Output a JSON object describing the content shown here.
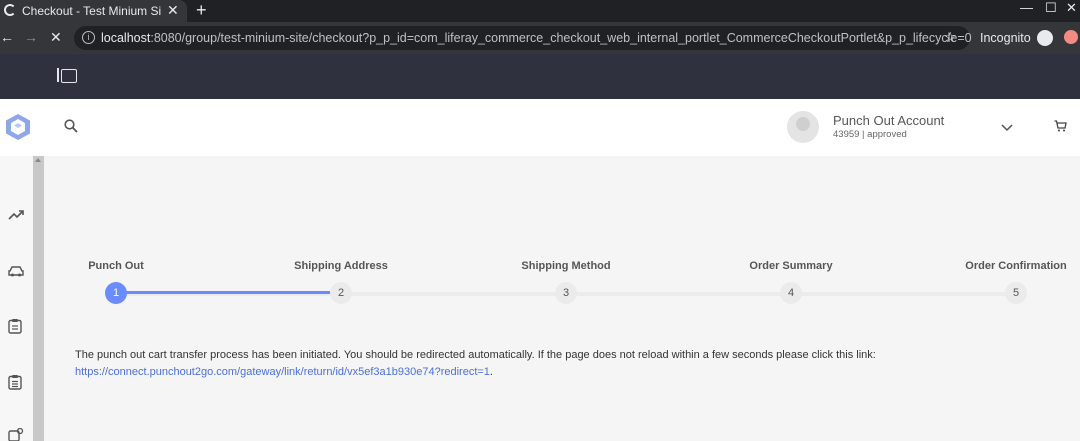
{
  "browser": {
    "tab_title": "Checkout - Test Minium Si",
    "new_tab": "+",
    "url_host": "localhost",
    "url_rest": ":8080/group/test-minium-site/checkout?p_p_id=com_liferay_commerce_checkout_web_internal_portlet_CommerceCheckoutPortlet&p_p_lifecycle=0",
    "incognito_label": "Incognito"
  },
  "account": {
    "name": "Punch Out Account",
    "status": "43959 | approved"
  },
  "steps": [
    {
      "label": "Punch Out",
      "number": "1"
    },
    {
      "label": "Shipping Address",
      "number": "2"
    },
    {
      "label": "Shipping Method",
      "number": "3"
    },
    {
      "label": "Order Summary",
      "number": "4"
    },
    {
      "label": "Order Confirmation",
      "number": "5"
    }
  ],
  "progress": {
    "active_step": 1,
    "completed_fraction": 0.25
  },
  "message": {
    "text": "The punch out cart transfer process has been initiated. You should be redirected automatically. If the page does not reload within a few seconds please click this link:",
    "link": "https://connect.punchout2go.com/gateway/link/return/id/vx5ef3a1b930e74?redirect=1",
    "suffix": "."
  },
  "colors": {
    "accent": "#6b8cff",
    "control_bar": "#30313f"
  },
  "icons": [
    "search-icon",
    "chevron-down-icon",
    "cart-icon",
    "trend-icon",
    "car-icon",
    "clipboard-icon",
    "clipboard-list-icon",
    "account-settings-icon"
  ]
}
